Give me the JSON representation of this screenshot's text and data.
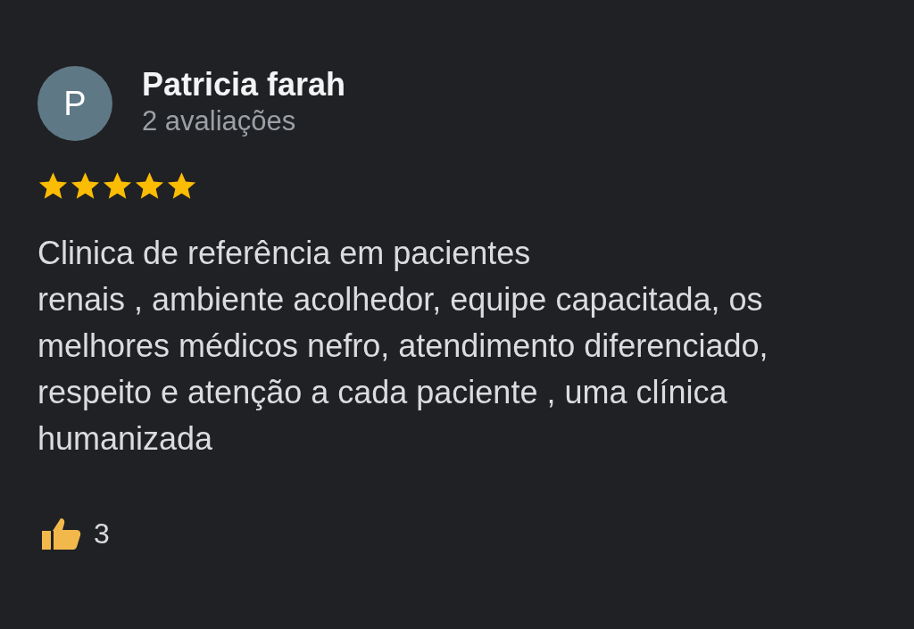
{
  "review": {
    "avatar_letter": "P",
    "author": "Patricia farah",
    "author_meta": "2 avaliações",
    "stars": 5,
    "text": "Clinica de referência em pacientes\nrenais , ambiente acolhedor, equipe capacitada, os melhores médicos nefro, atendimento diferenciado, respeito e atenção a cada paciente , uma clínica humanizada",
    "likes": "3"
  }
}
